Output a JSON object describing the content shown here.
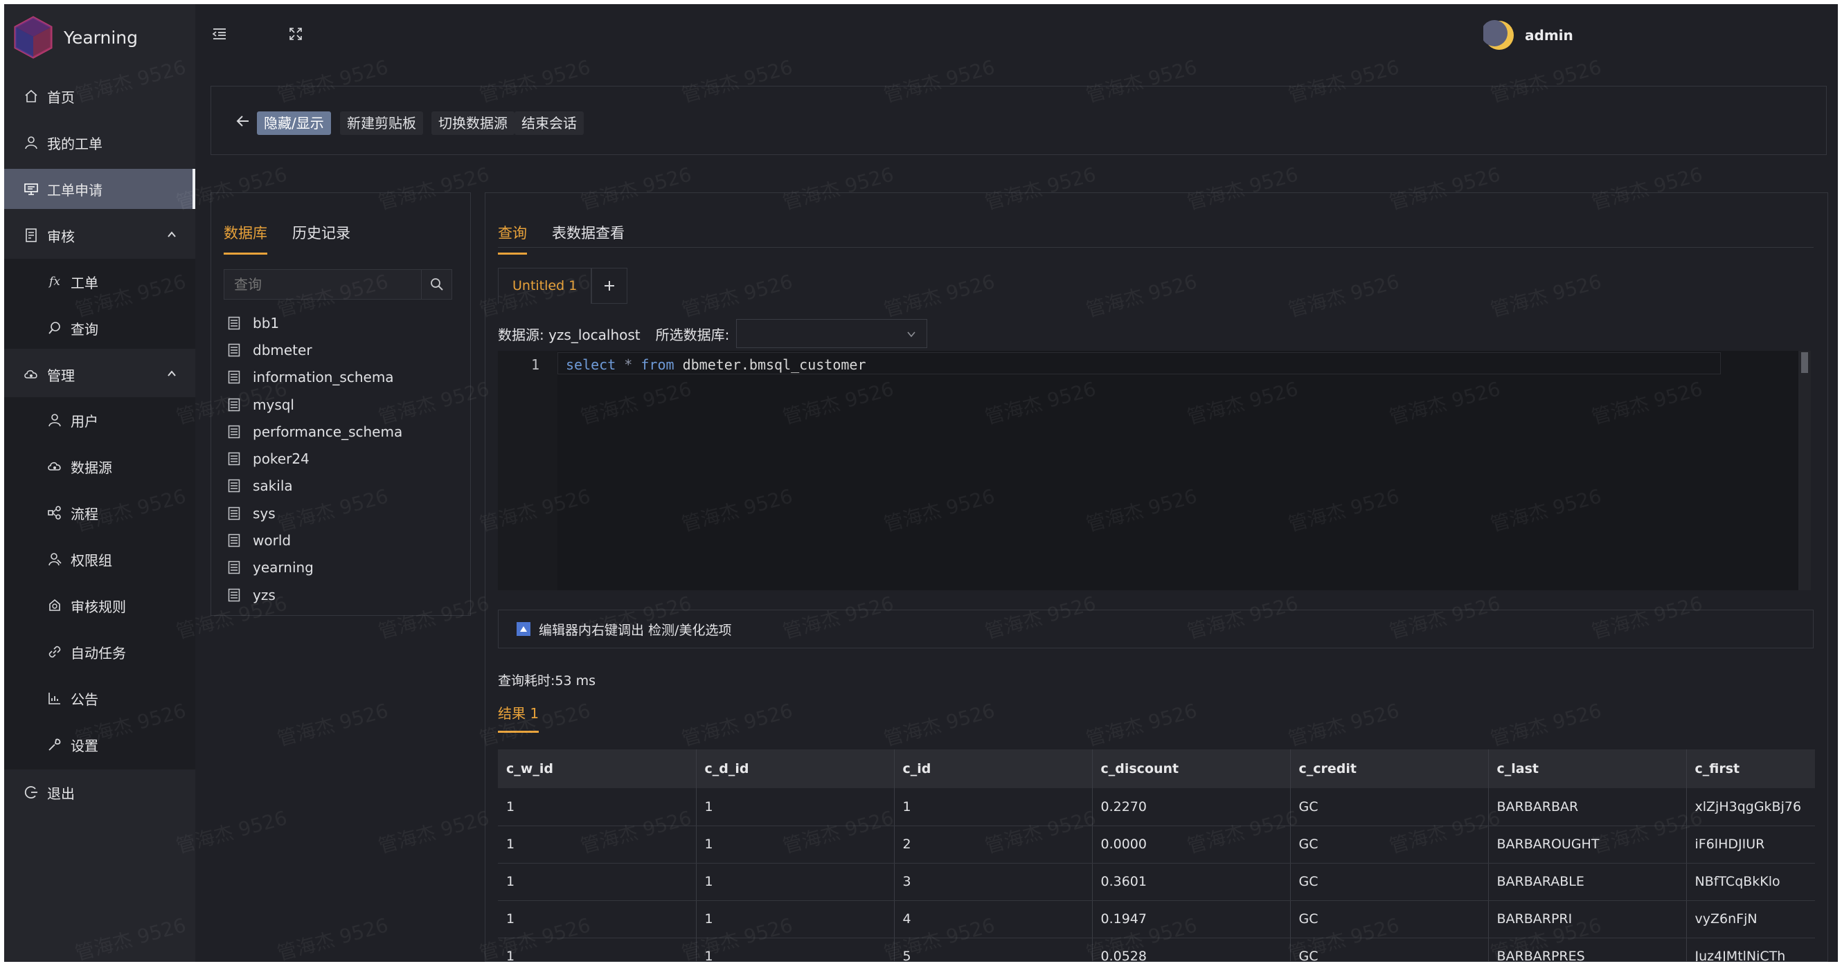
{
  "app": {
    "name": "Yearning"
  },
  "sidebar": {
    "items": [
      {
        "label": "首页",
        "icon": "home-icon"
      },
      {
        "label": "我的工单",
        "icon": "user-icon"
      },
      {
        "label": "工单申请",
        "icon": "monitor-icon",
        "active": true
      },
      {
        "label": "审核",
        "icon": "audit-icon",
        "expanded": true
      },
      {
        "label": "工单",
        "icon": "function-icon",
        "sub": true
      },
      {
        "label": "查询",
        "icon": "search-icon",
        "sub": true
      },
      {
        "label": "管理",
        "icon": "cloud-icon",
        "expanded": true
      },
      {
        "label": "用户",
        "icon": "user-icon",
        "sub": true
      },
      {
        "label": "数据源",
        "icon": "cloud-icon",
        "sub": true
      },
      {
        "label": "流程",
        "icon": "flow-icon",
        "sub": true
      },
      {
        "label": "权限组",
        "icon": "group-icon",
        "sub": true
      },
      {
        "label": "审核规则",
        "icon": "rule-icon",
        "sub": true
      },
      {
        "label": "自动任务",
        "icon": "link-icon",
        "sub": true
      },
      {
        "label": "公告",
        "icon": "chart-icon",
        "sub": true
      },
      {
        "label": "设置",
        "icon": "wrench-icon",
        "sub": true
      },
      {
        "label": "退出",
        "icon": "logout-icon"
      }
    ]
  },
  "header": {
    "user": "admin"
  },
  "toolbar": {
    "toggle_label": "隐藏/显示",
    "new_clipboard_label": "新建剪贴板",
    "switch_source_label": "切换数据源",
    "end_session_label": "结束会话"
  },
  "db_panel": {
    "tabs": [
      "数据库",
      "历史记录"
    ],
    "search_placeholder": "查询",
    "databases": [
      "bb1",
      "dbmeter",
      "information_schema",
      "mysql",
      "performance_schema",
      "poker24",
      "sakila",
      "sys",
      "world",
      "yearning",
      "yzs"
    ]
  },
  "query_panel": {
    "tabs": [
      "查询",
      "表数据查看"
    ],
    "editor_tab": "Untitled 1",
    "source_label": "数据源: yzs_localhost",
    "db_select_label": "所选数据库:",
    "db_select_value": "",
    "line_number": "1",
    "sql": {
      "k1": "select",
      "star": " * ",
      "k2": "from",
      "rest": " dbmeter.bmsql_customer"
    },
    "hint": "编辑器内右键调出 检测/美化选项",
    "elapsed": "查询耗时:53 ms",
    "result_tab": "结果 1"
  },
  "table": {
    "columns": [
      "c_w_id",
      "c_d_id",
      "c_id",
      "c_discount",
      "c_credit",
      "c_last",
      "c_first"
    ],
    "rows": [
      [
        "1",
        "1",
        "1",
        "0.2270",
        "GC",
        "BARBARBAR",
        "xlZjH3qgGkBj76"
      ],
      [
        "1",
        "1",
        "2",
        "0.0000",
        "GC",
        "BARBAROUGHT",
        "iF6lHDJIUR"
      ],
      [
        "1",
        "1",
        "3",
        "0.3601",
        "GC",
        "BARBARABLE",
        "NBfTCqBkKlo"
      ],
      [
        "1",
        "1",
        "4",
        "0.1947",
        "GC",
        "BARBARPRI",
        "vyZ6nFjN"
      ],
      [
        "1",
        "1",
        "5",
        "0.0528",
        "GC",
        "BARBARPRES",
        "Juz4JMtlNiCTh"
      ]
    ]
  },
  "watermark": "管海杰 9526",
  "colors": {
    "accent": "#e8a23a",
    "background": "#1f2026",
    "sidebar": "#25262c",
    "active_item": "#54596a",
    "primary_button": "#6a7a97",
    "keyword": "#6f9bd8"
  }
}
